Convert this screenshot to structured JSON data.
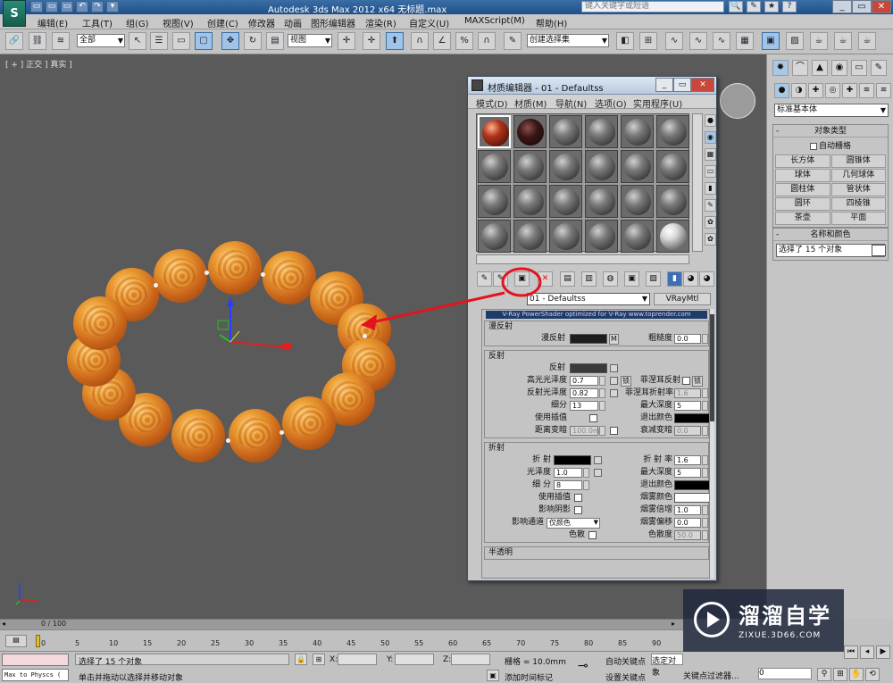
{
  "app": {
    "logo_text": "S",
    "title": "Autodesk 3ds Max  2012 x64    无标题.max",
    "search_placeholder": "键入关键字或短语"
  },
  "quick_access": [
    "▭",
    "▭",
    "▭",
    "↶",
    "↷",
    "▾"
  ],
  "title_icons": [
    "🔍",
    "✎",
    "★",
    "?"
  ],
  "window_controls": {
    "minimize": "_",
    "maximize": "▭",
    "close": "✕"
  },
  "menubar": [
    "编辑(E)",
    "工具(T)",
    "组(G)",
    "视图(V)",
    "创建(C)",
    "修改器",
    "动画",
    "图形编辑器",
    "渲染(R)",
    "自定义(U)",
    "MAXScript(M)",
    "帮助(H)"
  ],
  "toolbar": {
    "selection_filter": "全部",
    "ref_coord": "视图",
    "named_selection": "创建选择集",
    "buttons": [
      "🔗",
      "⛓",
      "≋",
      "↖",
      "☰",
      "▭",
      "▢",
      "✥",
      "↻",
      "▤",
      "✛",
      "⬆",
      "∩",
      "∠",
      "%",
      "∩",
      "✎",
      "◧",
      "⊞",
      "∿",
      "▦",
      "▣",
      "▨",
      "☕",
      "☕"
    ]
  },
  "viewport": {
    "label": "[ + ] 正交 ] 真实 ]",
    "beads": 15
  },
  "command_panel": {
    "tabs": [
      "✹",
      "⌒",
      "▲",
      "◉",
      "▭",
      "✎"
    ],
    "sub_tabs": [
      "●",
      "◑",
      "✚",
      "◎",
      "✚",
      "≋",
      "≋"
    ],
    "category_dropdown": "标准基本体",
    "object_type": {
      "title": "对象类型",
      "autogrid": "自动栅格",
      "buttons": [
        "长方体",
        "圆锥体",
        "球体",
        "几何球体",
        "圆柱体",
        "管状体",
        "圆环",
        "四棱锥",
        "茶壶",
        "平面"
      ]
    },
    "name_color": {
      "title": "名称和颜色",
      "value": "选择了 15 个对象"
    }
  },
  "material_editor": {
    "title": "材质编辑器 - 01 - Defaultss",
    "menus": [
      "模式(D)",
      "材质(M)",
      "导航(N)",
      "选项(O)",
      "实用程序(U)"
    ],
    "material_name": "01 - Defaultss",
    "material_type": "VRayMtl",
    "banner": "V-Ray PowerShader    optimized for V-Ray    www.toprender.com",
    "side_icons": [
      "●",
      "◉",
      "▦",
      "▭",
      "▮",
      "✎",
      "✿",
      "✿"
    ],
    "toolbar_icons": [
      "✎",
      "▣",
      "✕",
      "▤",
      "▥",
      "◍",
      "▣",
      "▨",
      "▮",
      "◕",
      "◕",
      "◕"
    ],
    "diffuse": {
      "title": "漫反射",
      "diffuse_label": "漫反射",
      "map_button": "M",
      "roughness_label": "粗糙度",
      "roughness_value": "0.0"
    },
    "reflection": {
      "title": "反射",
      "reflect_label": "反射",
      "hilight_gloss_label": "高光光泽度",
      "hilight_gloss_value": "0.7",
      "lock_label": "锁",
      "fresnel_label": "菲涅耳反射",
      "refl_gloss_label": "反射光泽度",
      "refl_gloss_value": "0.82",
      "fresnel_ior_label": "菲涅耳折射率",
      "fresnel_ior_value": "1.6",
      "subdivs_label": "细分",
      "subdivs_value": "13",
      "max_depth_label": "最大深度",
      "max_depth_value": "5",
      "use_interp_label": "使用插值",
      "exit_color_label": "退出颜色",
      "dim_distance_label": "距离变暗",
      "dim_distance_value": "100.0m",
      "dim_falloff_label": "衰减变暗",
      "dim_falloff_value": "0.0"
    },
    "refraction": {
      "title": "折射",
      "refract_label": "折 射",
      "ior_label": "折 射 率",
      "ior_value": "1.6",
      "gloss_label": "光泽度",
      "gloss_value": "1.0",
      "max_depth_label": "最大深度",
      "max_depth_value": "5",
      "subdivs_label": "细 分",
      "subdivs_value": "8",
      "exit_color_label": "退出颜色",
      "use_interp_label": "使用插值",
      "fog_color_label": "烟雾颜色",
      "affect_shadows_label": "影响阴影",
      "fog_mult_label": "烟雾倍增",
      "fog_mult_value": "1.0",
      "affect_channels_label": "影响通道",
      "affect_channels_value": "仅颜色",
      "fog_bias_label": "烟雾偏移",
      "fog_bias_value": "0.0",
      "dispersion_label": "色散",
      "abbe_label": "色散度",
      "abbe_value": "50.0"
    },
    "translucency_title": "半透明"
  },
  "timeline": {
    "frame_label": "0 / 100",
    "ticks": [
      "0",
      "5",
      "10",
      "15",
      "20",
      "25",
      "30",
      "35",
      "40",
      "45",
      "50",
      "55",
      "60",
      "65",
      "70",
      "75",
      "80",
      "85",
      "90"
    ]
  },
  "status": {
    "maxscript": "Max to Physcs (",
    "selected": "选择了 15 个对象",
    "prompt": "单击并拖动以选择并移动对象",
    "x_label": "X:",
    "y_label": "Y:",
    "z_label": "Z:",
    "grid": "栅格 = 10.0mm",
    "add_time_tag": "添加时间标记",
    "auto_key": "自动关键点",
    "set_key": "设置关键点",
    "selected_obj": "选定对象",
    "key_filters": "关键点过滤器...",
    "frame_value": "0"
  },
  "watermark": {
    "title": "溜溜自学",
    "url": "ZIXUE.3D66.COM"
  },
  "colors": {
    "annotation": "#e3141e",
    "viewport_bg": "#5a5a5a"
  }
}
